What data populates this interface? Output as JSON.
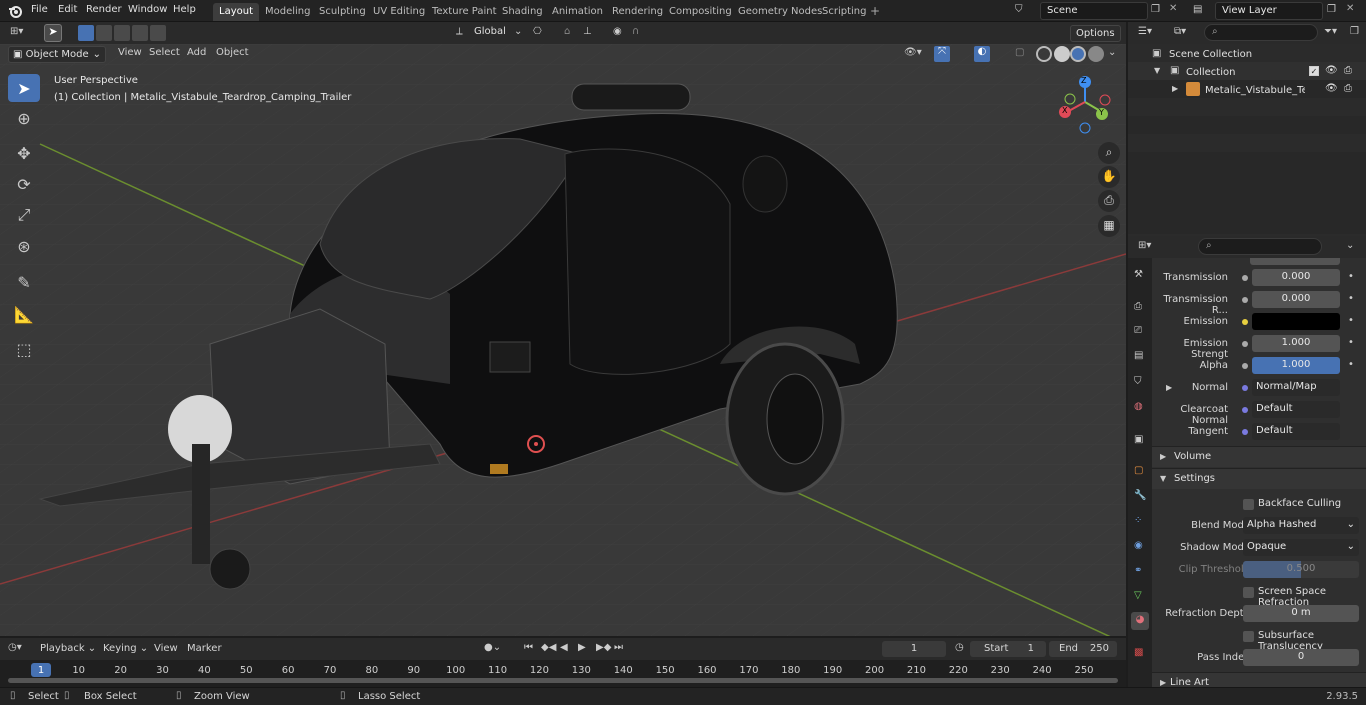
{
  "topbar": {
    "menus": [
      "File",
      "Edit",
      "Render",
      "Window",
      "Help"
    ],
    "workspaces": [
      "Layout",
      "Modeling",
      "Sculpting",
      "UV Editing",
      "Texture Paint",
      "Shading",
      "Animation",
      "Rendering",
      "Compositing",
      "Geometry Nodes",
      "Scripting"
    ],
    "active_workspace": "Layout",
    "scene": "Scene",
    "view_layer": "View Layer"
  },
  "tool_header": {
    "orientation": "Global",
    "options": "Options"
  },
  "viewport_header": {
    "mode": "Object Mode",
    "menus": [
      "View",
      "Select",
      "Add",
      "Object"
    ]
  },
  "viewport": {
    "perspective": "User Perspective",
    "collection_info": "(1) Collection | Metalic_Vistabule_Teardrop_Camping_Trailer",
    "gizmo_axes": {
      "z": "Z",
      "y": "Y",
      "x": "X"
    }
  },
  "outliner": {
    "scene_collection": "Scene Collection",
    "collection": "Collection",
    "object": "Metalic_Vistabule_Teardr"
  },
  "properties": {
    "rows": [
      {
        "label": "Transmission",
        "value": "0.000"
      },
      {
        "label": "Transmission R...",
        "value": "0.000"
      },
      {
        "label": "Emission",
        "value": ""
      },
      {
        "label": "Emission Strengt",
        "value": "1.000"
      },
      {
        "label": "Alpha",
        "value": "1.000"
      },
      {
        "label": "Normal",
        "value": "Normal/Map"
      },
      {
        "label": "Clearcoat Normal",
        "value": "Default"
      },
      {
        "label": "Tangent",
        "value": "Default"
      }
    ],
    "volume": "Volume",
    "settings": "Settings",
    "backface": "Backface Culling",
    "blend_label": "Blend Mode",
    "blend_value": "Alpha Hashed",
    "shadow_label": "Shadow Mode",
    "shadow_value": "Opaque",
    "clip_label": "Clip Threshold",
    "clip_value": "0.500",
    "ssr": "Screen Space Refraction",
    "refr_label": "Refraction Depth",
    "refr_value": "0 m",
    "sss": "Subsurface Translucency",
    "pass_label": "Pass Index",
    "pass_value": "0",
    "line_art": "Line Art"
  },
  "timeline": {
    "menus": [
      "Playback",
      "Keying",
      "View",
      "Marker"
    ],
    "current_frame": "1",
    "start_label": "Start",
    "start": "1",
    "end_label": "End",
    "end": "250",
    "ticks": [
      "1",
      "10",
      "20",
      "30",
      "40",
      "50",
      "60",
      "70",
      "80",
      "90",
      "100",
      "110",
      "120",
      "130",
      "140",
      "150",
      "160",
      "170",
      "180",
      "190",
      "200",
      "210",
      "220",
      "230",
      "240",
      "250"
    ]
  },
  "status": {
    "select": "Select",
    "box_select": "Box Select",
    "zoom": "Zoom View",
    "lasso": "Lasso Select",
    "version": "2.93.5"
  },
  "colors": {
    "accent": "#4772b3",
    "x_axis": "#e04a57",
    "y_axis": "#8bc34a",
    "z_axis": "#3f8ff2"
  }
}
